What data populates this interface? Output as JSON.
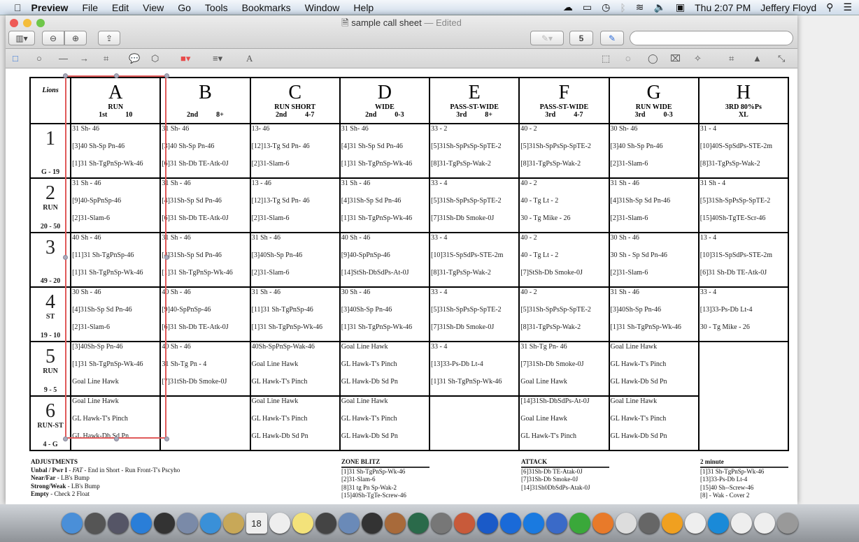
{
  "menubar": {
    "app": "Preview",
    "items": [
      "File",
      "Edit",
      "View",
      "Go",
      "Tools",
      "Bookmarks",
      "Window",
      "Help"
    ],
    "clock": "Thu 2:07 PM",
    "user": "Jeffery Floyd"
  },
  "window": {
    "title": "sample call sheet",
    "status": "— Edited",
    "search_placeholder": "",
    "rotate_label": "5"
  },
  "sheet": {
    "corner": "Lions",
    "columns": [
      {
        "letter": "A",
        "play": "RUN",
        "down": "1st",
        "dist": "10"
      },
      {
        "letter": "B",
        "play": "",
        "down": "2nd",
        "dist": "8+"
      },
      {
        "letter": "C",
        "play": "RUN SHORT",
        "down": "2nd",
        "dist": "4-7"
      },
      {
        "letter": "D",
        "play": "WIDE",
        "down": "2nd",
        "dist": "0-3"
      },
      {
        "letter": "E",
        "play": "PASS-ST-WIDE",
        "down": "3rd",
        "dist": "8+"
      },
      {
        "letter": "F",
        "play": "PASS-ST-WIDE",
        "down": "3rd",
        "dist": "4-7"
      },
      {
        "letter": "G",
        "play": "RUN WIDE",
        "down": "3rd",
        "dist": "0-3"
      },
      {
        "letter": "H",
        "play": "3RD 80%Ps",
        "down": "XL",
        "dist": ""
      }
    ],
    "rows": [
      {
        "num": "1",
        "label": "",
        "range": "G - 19",
        "cells": [
          [
            "31 Sh- 46",
            "[3]40 Sh-Sp Pn-46",
            "[1]31 Sh-TgPnSp-Wk-46"
          ],
          [
            "31 Sh- 46",
            "[3]40 Sh-Sp Pn-46",
            "[6]31 Sh-Db TE-Atk-0J"
          ],
          [
            "13- 46",
            "[12]13-Tg Sd Pn- 46",
            "[2]31-Slam-6"
          ],
          [
            "31 Sh- 46",
            "[4]31 Sh-Sp Sd Pn-46",
            "[1]31 Sh-TgPnSp-Wk-46"
          ],
          [
            "33 - 2",
            "[5]31Sh-SpPsSp-SpTE-2",
            "[8]31-TgPsSp-Wak-2"
          ],
          [
            "40 - 2",
            "[5]31Sh-SpPsSp-SpTE-2",
            "[8]31-TgPsSp-Wak-2"
          ],
          [
            "30 Sh- 46",
            "[3]40 Sh-Sp Pn-46",
            "[2]31-Slam-6"
          ],
          [
            "31 - 4",
            "[10]40S-SpSdPs-STE-2m",
            "[8]31-TgPsSp-Wak-2"
          ]
        ]
      },
      {
        "num": "2",
        "label": "RUN",
        "range": "20 - 50",
        "cells": [
          [
            "31 Sh - 46",
            "[9]40-SpPnSp-46",
            "[2]31-Slam-6"
          ],
          [
            "31 Sh - 46",
            "[4]31Sh-Sp Sd Pn-46",
            "[6]31 Sh-Db TE-Atk-0J"
          ],
          [
            "13 - 46",
            "[12]13-Tg Sd Pn- 46",
            "[2]31-Slam-6"
          ],
          [
            "31 Sh - 46",
            "[4]31Sh-Sp Sd Pn-46",
            "[1]31 Sh-TgPnSp-Wk-46"
          ],
          [
            "33 - 4",
            "[5]31Sh-SpPsSp-SpTE-2",
            "[7]31Sh-Db Smoke-0J"
          ],
          [
            "40 - 2",
            "40 - Tg Lt - 2",
            "30 - Tg Mike - 26"
          ],
          [
            "31 Sh - 46",
            "[4]31Sh-Sp Sd Pn-46",
            "[2]31-Slam-6"
          ],
          [
            "31 Sh - 4",
            "[5]31Sh-SpPsSp-SpTE-2",
            "[15]40Sh-TgTE-Scr-46"
          ]
        ]
      },
      {
        "num": "3",
        "label": "",
        "range": "49 - 20",
        "cells": [
          [
            "40 Sh - 46",
            "[11]31 Sh-TgPnSp-46",
            "[1]31 Sh-TgPnSp-Wk-46"
          ],
          [
            "31 Sh - 46",
            "[4]31Sh-Sp Sd Pn-46",
            "[1]31 Sh-TgPnSp-Wk-46"
          ],
          [
            "31 Sh - 46",
            "[3]40Sh-Sp Pn-46",
            "[2]31-Slam-6"
          ],
          [
            "40 Sh - 46",
            "[9]40-SpPnSp-46",
            "[14]StSh-DbSdPs-At-0J"
          ],
          [
            "33 - 4",
            "[10]31S-SpSdPs-STE-2m",
            "[8]31-TgPsSp-Wak-2"
          ],
          [
            "40 - 2",
            "40 - Tg Lt - 2",
            "[7]StSh-Db Smoke-0J"
          ],
          [
            "30 Sh - 46",
            "30 Sh - Sp Sd Pn-46",
            "[2]31-Slam-6"
          ],
          [
            "13 - 4",
            "[10]31S-SpSdPs-STE-2m",
            "[6]31 Sh-Db TE-Atk-0J"
          ]
        ]
      },
      {
        "num": "4",
        "label": "ST",
        "range": "19 - 10",
        "cells": [
          [
            "30 Sh - 46",
            "[4]31Sh-Sp Sd Pn-46",
            "[2]31-Slam-6"
          ],
          [
            "40 Sh - 46",
            "[9]40-SpPnSp-46",
            "[6]31 Sh-Db TE-Atk-0J"
          ],
          [
            "31 Sh - 46",
            "[11]31 Sh-TgPnSp-46",
            "[1]31 Sh-TgPnSp-Wk-46"
          ],
          [
            "30 Sh - 46",
            "[3]40Sh-Sp Pn-46",
            "[1]31 Sh-TgPnSp-Wk-46"
          ],
          [
            "33 - 4",
            "[5]31Sh-SpPsSp-SpTE-2",
            "[7]31Sh-Db Smoke-0J"
          ],
          [
            "40 - 2",
            "[5]31Sh-SpPsSp-SpTE-2",
            "[8]31-TgPsSp-Wak-2"
          ],
          [
            "31 Sh - 46",
            "[3]40Sh-Sp Pn-46",
            "[1]31 Sh-TgPnSp-Wk-46"
          ],
          [
            "33 - 4",
            "[13]33-Ps-Db Lt-4",
            "30 - Tg Mike - 26"
          ]
        ]
      },
      {
        "num": "5",
        "label": "RUN",
        "range": "9 - 5",
        "cells": [
          [
            "[3]40Sh-Sp Pn-46",
            "[1]31 Sh-TgPnSp-Wk-46",
            "Goal Line Hawk"
          ],
          [
            "40 Sh - 46",
            "31 Sh-Tg Pn - 4",
            "[7]31tSh-Db Smoke-0J"
          ],
          [
            "40Sh-SpPnSp-Wak-46",
            "Goal Line Hawk",
            "GL Hawk-T's Pinch"
          ],
          [
            "Goal Line Hawk",
            "GL Hawk-T's Pinch",
            "GL Hawk-Db Sd Pn"
          ],
          [
            "33 - 4",
            "[13]33-Ps-Db Lt-4",
            "[1]31 Sh-TgPnSp-Wk-46"
          ],
          [
            "31 Sh-Tg Pn- 46",
            "[7]31Sh-Db Smoke-0J",
            "Goal Line Hawk"
          ],
          [
            "Goal Line Hawk",
            "GL Hawk-T's Pinch",
            "GL Hawk-Db Sd Pn"
          ],
          []
        ]
      },
      {
        "num": "6",
        "label": "RUN-ST",
        "range": "4 - G",
        "cells": [
          [
            "Goal Line Hawk",
            "GL Hawk-T's Pinch",
            "GL Hawk-Db Sd Pn"
          ],
          [],
          [
            "Goal Line Hawk",
            "GL Hawk-T's Pinch",
            "GL Hawk-Db Sd Pn"
          ],
          [
            "Goal Line Hawk",
            "GL Hawk-T's Pinch",
            "GL Hawk-Db Sd Pn"
          ],
          [],
          [
            "[14]31Sh-DbSdPs-At-0J",
            "Goal Line Hawk",
            "GL Hawk-T's Pinch"
          ],
          [
            "Goal Line Hawk",
            "GL Hawk-T's Pinch",
            "GL Hawk-Db Sd Pn"
          ]
        ]
      }
    ]
  },
  "adjustments": {
    "title": "ADJUSTMENTS",
    "items": [
      {
        "key": "Unbal / Pwr I",
        "italic": "FAT",
        "text": " - End in Short - Run Front-T's Pscyho"
      },
      {
        "key": "Near/Far",
        "italic": "",
        "text": " - LB's Bump"
      },
      {
        "key": "Strong/Weak",
        "italic": "",
        "text": " - LB's Bump"
      },
      {
        "key": "Empty",
        "italic": "",
        "text": " - Check 2 Float"
      }
    ]
  },
  "zone_blitz": {
    "title": "ZONE BLITZ",
    "items": [
      "[1]31 Sh-TgPnSp-Wk-46",
      "[2]31-Slam-6",
      "[8]31 tg Pn Sp-Wak-2",
      "[15]40Sh-TgTe-Screw-46"
    ]
  },
  "attack": {
    "title": "ATTACK",
    "items": [
      "[6]31Sh-Db TE-Atak-0J",
      "[7]31Sh-Db Smoke-0J",
      "[14]31Sh0DbSdPs-Atak-0J"
    ]
  },
  "two_minute": {
    "title": "2 minute",
    "items": [
      "[1]31 Sh-TgPnSp-Wk-46",
      "[13]33-Ps-Db Lt-4",
      "[15]40 Sh--Screw-46",
      "[8] - Wak - Cover 2"
    ]
  },
  "dock": {
    "icons": [
      "finder",
      "launchpad",
      "dashboard-widgets",
      "app-store",
      "dashboard",
      "preview",
      "safari",
      "contacts",
      "calendar",
      "reminders",
      "notes",
      "photo-booth",
      "iphoto",
      "imovie",
      "garageband",
      "time-machine",
      "system-preferences",
      "photo-app",
      "dvd-player",
      "quicktime",
      "itunes",
      "word",
      "excel",
      "powerpoint",
      "x-app",
      "facetime",
      "vlc",
      "folder",
      "quicktime-x",
      "document",
      "document",
      "trash"
    ],
    "colors": [
      "#4a8fd8",
      "#555",
      "#556",
      "#2a7ed8",
      "#333",
      "#7a8aa8",
      "#3a90d8",
      "#c8a858",
      "#eee",
      "#eee",
      "#f3e27a",
      "#444",
      "#6a8ab8",
      "#333",
      "#a86a3a",
      "#2a6a4a",
      "#777",
      "#c85a3a",
      "#1a5ac8",
      "#1a6ad8",
      "#1a7ae0",
      "#3a6ac8",
      "#3aa83a",
      "#e87a2a",
      "#ddd",
      "#666",
      "#f0a020",
      "#eee",
      "#1a8ad8",
      "#eee",
      "#eee",
      "#999"
    ]
  },
  "colors": {
    "selection": "#e05a5a",
    "annotation_color": "#e84a4a"
  }
}
